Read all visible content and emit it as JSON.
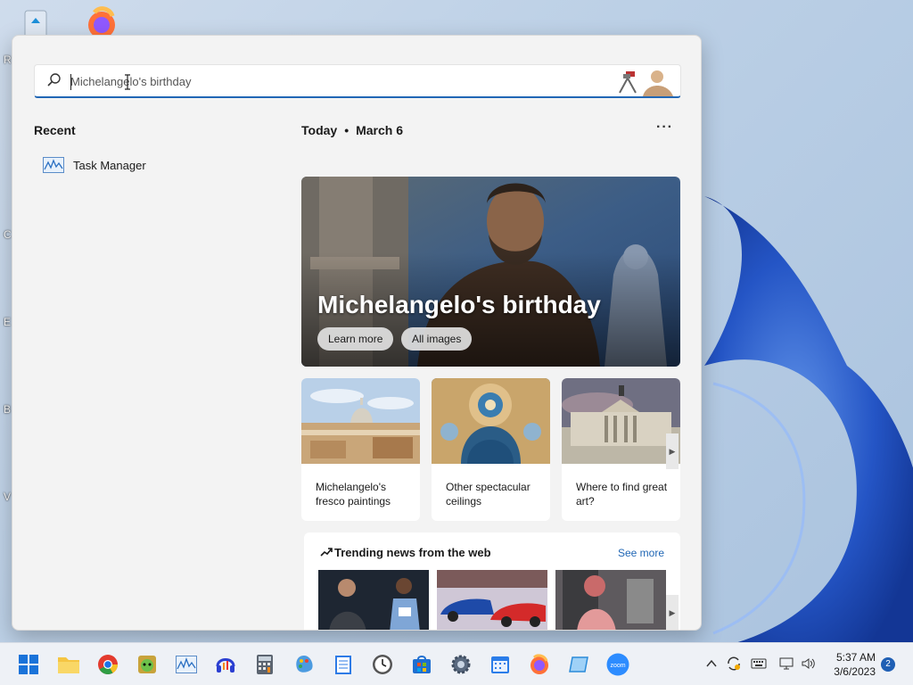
{
  "search": {
    "value": "Michelangelo's birthday"
  },
  "recent": {
    "title": "Recent",
    "items": [
      {
        "label": "Task Manager",
        "icon": "task-manager-icon"
      }
    ]
  },
  "today": {
    "label": "Today",
    "separator": "•",
    "date": "March 6",
    "more": "···"
  },
  "hero": {
    "title": "Michelangelo's birthday",
    "learn_more": "Learn more",
    "all_images": "All images"
  },
  "cards": [
    {
      "caption": "Michelangelo's fresco paintings"
    },
    {
      "caption": "Other spectacular ceilings"
    },
    {
      "caption": "Where to find great art?"
    }
  ],
  "trending": {
    "title": "Trending news from the web",
    "see_more": "See more"
  },
  "desktop": {
    "side_letters": [
      "R",
      "C",
      "E",
      "B",
      "V"
    ]
  },
  "taskbar": {
    "icons": [
      "start-icon",
      "file-explorer-icon",
      "chrome-icon",
      "game-icon",
      "task-manager-icon",
      "audio-app-icon",
      "calculator-icon",
      "paint-icon",
      "notepad-icon",
      "clock-icon",
      "store-icon",
      "settings-icon",
      "calendar-icon",
      "firefox-icon",
      "snip-icon",
      "zoom-icon"
    ],
    "zoom_label": "zoom",
    "time": "5:37 AM",
    "date": "3/6/2023",
    "notifications": "2"
  },
  "colors": {
    "accent": "#2167b5",
    "taskbar": "#eef1f6",
    "panel": "#f3f3f3"
  }
}
